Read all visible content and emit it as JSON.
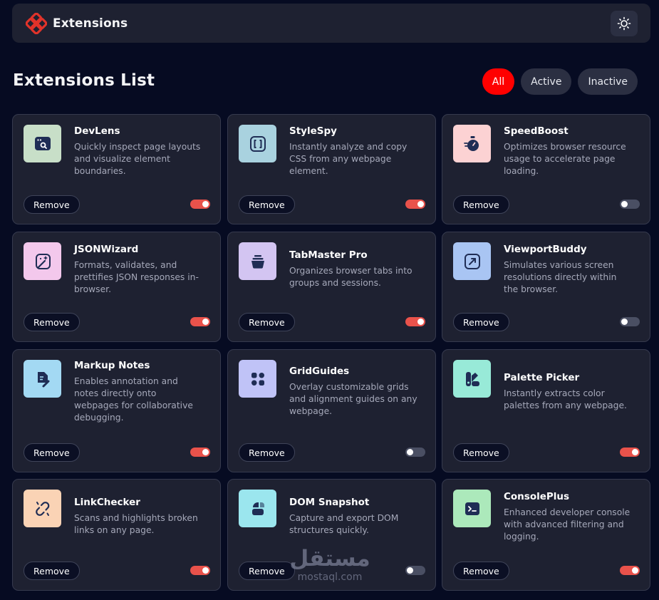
{
  "header": {
    "brand_name": "Extensions",
    "logo_icon": "extensions-logo-icon",
    "theme_icon": "sun-icon"
  },
  "page": {
    "title": "Extensions List"
  },
  "filters": {
    "items": [
      "All",
      "Active",
      "Inactive"
    ],
    "selected": "All"
  },
  "colors": {
    "accent": "#f00",
    "toggle_on": "#e9524b",
    "toggle_off": "#4a4f63",
    "card_bg": "#1e2131",
    "page_bg": "#060b22"
  },
  "extensions": [
    {
      "name": "DevLens",
      "description": "Quickly inspect page layouts and visualize element boundaries.",
      "active": true,
      "icon": "browser-search-icon",
      "icon_bg": "#c8dfc8",
      "remove_label": "Remove"
    },
    {
      "name": "StyleSpy",
      "description": "Instantly analyze and copy CSS from any webpage element.",
      "active": true,
      "icon": "brackets-icon",
      "icon_bg": "#a9d2df",
      "remove_label": "Remove"
    },
    {
      "name": "SpeedBoost",
      "description": "Optimizes browser resource usage to accelerate page loading.",
      "active": false,
      "icon": "stopwatch-icon",
      "icon_bg": "#fcd2d3",
      "remove_label": "Remove"
    },
    {
      "name": "JSONWizard",
      "description": "Formats, validates, and prettifies JSON responses in-browser.",
      "active": true,
      "icon": "magic-wand-icon",
      "icon_bg": "#f3c8ec",
      "remove_label": "Remove"
    },
    {
      "name": "TabMaster Pro",
      "description": "Organizes browser tabs into groups and sessions.",
      "active": true,
      "icon": "stacked-tabs-icon",
      "icon_bg": "#d3c5f2",
      "remove_label": "Remove"
    },
    {
      "name": "ViewportBuddy",
      "description": "Simulates various screen resolutions directly within the browser.",
      "active": false,
      "icon": "resize-arrow-icon",
      "icon_bg": "#a9c5f3",
      "remove_label": "Remove"
    },
    {
      "name": "Markup Notes",
      "description": "Enables annotation and notes directly onto webpages for collaborative debugging.",
      "active": true,
      "icon": "note-edit-icon",
      "icon_bg": "#a3d9f3",
      "remove_label": "Remove"
    },
    {
      "name": "GridGuides",
      "description": "Overlay customizable grids and alignment guides on any webpage.",
      "active": false,
      "icon": "grid-icon",
      "icon_bg": "#c0c3f7",
      "remove_label": "Remove"
    },
    {
      "name": "Palette Picker",
      "description": "Instantly extracts color palettes from any webpage.",
      "active": true,
      "icon": "palette-icon",
      "icon_bg": "#98ead8",
      "remove_label": "Remove"
    },
    {
      "name": "LinkChecker",
      "description": "Scans and highlights broken links on any page.",
      "active": true,
      "icon": "broken-link-icon",
      "icon_bg": "#fad3b5",
      "remove_label": "Remove"
    },
    {
      "name": "DOM Snapshot",
      "description": "Capture and export DOM structures quickly.",
      "active": false,
      "icon": "snapshot-icon",
      "icon_bg": "#9be6ee",
      "remove_label": "Remove"
    },
    {
      "name": "ConsolePlus",
      "description": "Enhanced developer console with advanced filtering and logging.",
      "active": true,
      "icon": "terminal-icon",
      "icon_bg": "#ace9bb",
      "remove_label": "Remove"
    }
  ],
  "watermark": {
    "arabic": "مستقل",
    "latin": "mostaql.com"
  }
}
